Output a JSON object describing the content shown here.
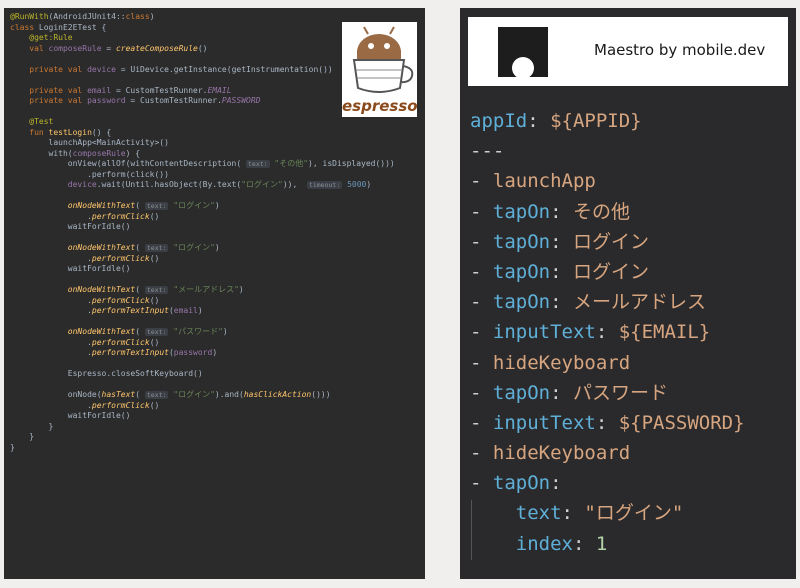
{
  "espresso": {
    "logo_text": "espresso",
    "lines": [
      {
        "i": 0,
        "parts": [
          [
            "ann",
            "@RunWith"
          ],
          [
            "t",
            "(AndroidJUnit4::"
          ],
          [
            "kw",
            "class"
          ],
          [
            "t",
            ")"
          ]
        ]
      },
      {
        "i": 0,
        "parts": [
          [
            "kw",
            "class "
          ],
          [
            "t",
            "LoginE2ETest {"
          ]
        ]
      },
      {
        "i": 1,
        "parts": [
          [
            "ann",
            "@get:Rule"
          ]
        ]
      },
      {
        "i": 1,
        "parts": [
          [
            "kw",
            "val "
          ],
          [
            "prop",
            "composeRule"
          ],
          [
            "t",
            " = "
          ],
          [
            "it",
            "createComposeRule"
          ],
          [
            "t",
            "()"
          ]
        ]
      },
      {
        "i": 0,
        "parts": []
      },
      {
        "i": 1,
        "parts": [
          [
            "kw",
            "private val "
          ],
          [
            "prop",
            "device"
          ],
          [
            "t",
            " = UiDevice.getInstance(getInstrumentation())"
          ]
        ]
      },
      {
        "i": 0,
        "parts": []
      },
      {
        "i": 1,
        "parts": [
          [
            "kw",
            "private val "
          ],
          [
            "prop",
            "email"
          ],
          [
            "t",
            " = CustomTestRunner."
          ],
          [
            "cnst",
            "EMAIL"
          ]
        ]
      },
      {
        "i": 1,
        "parts": [
          [
            "kw",
            "private val "
          ],
          [
            "prop",
            "password"
          ],
          [
            "t",
            " = CustomTestRunner."
          ],
          [
            "cnst",
            "PASSWORD"
          ]
        ]
      },
      {
        "i": 0,
        "parts": []
      },
      {
        "i": 1,
        "parts": [
          [
            "ann",
            "@Test"
          ]
        ]
      },
      {
        "i": 1,
        "parts": [
          [
            "kw",
            "fun "
          ],
          [
            "fn",
            "testLogin"
          ],
          [
            "t",
            "() {"
          ]
        ]
      },
      {
        "i": 2,
        "parts": [
          [
            "t",
            "launchApp<MainActivity>()"
          ]
        ]
      },
      {
        "i": 2,
        "parts": [
          [
            "t",
            "with("
          ],
          [
            "prop",
            "composeRule"
          ],
          [
            "t",
            ") {"
          ]
        ]
      },
      {
        "i": 3,
        "parts": [
          [
            "t",
            "onView(allOf(withContentDescription( "
          ],
          [
            "hint",
            "text:"
          ],
          [
            "str",
            " \"その他\""
          ],
          [
            "t",
            "), isDisplayed()))"
          ]
        ]
      },
      {
        "i": 4,
        "parts": [
          [
            "t",
            ".perform(click())"
          ]
        ]
      },
      {
        "i": 3,
        "parts": [
          [
            "prop",
            "device"
          ],
          [
            "t",
            ".wait(Until.hasObject(By.text("
          ],
          [
            "str",
            "\"ログイン\""
          ],
          [
            "t",
            ")),  "
          ],
          [
            "hint",
            "timeout:"
          ],
          [
            "num",
            " 5000"
          ],
          [
            "t",
            ")"
          ]
        ]
      },
      {
        "i": 0,
        "parts": []
      },
      {
        "i": 3,
        "parts": [
          [
            "it",
            "onNodeWithText"
          ],
          [
            "t",
            "( "
          ],
          [
            "hint",
            "text:"
          ],
          [
            "str",
            " \"ログイン\""
          ],
          [
            "t",
            ")"
          ]
        ]
      },
      {
        "i": 4,
        "parts": [
          [
            "t",
            "."
          ],
          [
            "it",
            "performClick"
          ],
          [
            "t",
            "()"
          ]
        ]
      },
      {
        "i": 3,
        "parts": [
          [
            "t",
            "waitForIdle()"
          ]
        ]
      },
      {
        "i": 0,
        "parts": []
      },
      {
        "i": 3,
        "parts": [
          [
            "it",
            "onNodeWithText"
          ],
          [
            "t",
            "( "
          ],
          [
            "hint",
            "text:"
          ],
          [
            "str",
            " \"ログイン\""
          ],
          [
            "t",
            ")"
          ]
        ]
      },
      {
        "i": 4,
        "parts": [
          [
            "t",
            "."
          ],
          [
            "it",
            "performClick"
          ],
          [
            "t",
            "()"
          ]
        ]
      },
      {
        "i": 3,
        "parts": [
          [
            "t",
            "waitForIdle()"
          ]
        ]
      },
      {
        "i": 0,
        "parts": []
      },
      {
        "i": 3,
        "parts": [
          [
            "it",
            "onNodeWithText"
          ],
          [
            "t",
            "( "
          ],
          [
            "hint",
            "text:"
          ],
          [
            "str",
            " \"メールアドレス\""
          ],
          [
            "t",
            ")"
          ]
        ]
      },
      {
        "i": 4,
        "parts": [
          [
            "t",
            "."
          ],
          [
            "it",
            "performClick"
          ],
          [
            "t",
            "()"
          ]
        ]
      },
      {
        "i": 4,
        "parts": [
          [
            "t",
            "."
          ],
          [
            "it",
            "performTextInput"
          ],
          [
            "t",
            "("
          ],
          [
            "prop",
            "email"
          ],
          [
            "t",
            ")"
          ]
        ]
      },
      {
        "i": 0,
        "parts": []
      },
      {
        "i": 3,
        "parts": [
          [
            "it",
            "onNodeWithText"
          ],
          [
            "t",
            "( "
          ],
          [
            "hint",
            "text:"
          ],
          [
            "str",
            " \"パスワード\""
          ],
          [
            "t",
            ")"
          ]
        ]
      },
      {
        "i": 4,
        "parts": [
          [
            "t",
            "."
          ],
          [
            "it",
            "performClick"
          ],
          [
            "t",
            "()"
          ]
        ]
      },
      {
        "i": 4,
        "parts": [
          [
            "t",
            "."
          ],
          [
            "it",
            "performTextInput"
          ],
          [
            "t",
            "("
          ],
          [
            "prop",
            "password"
          ],
          [
            "t",
            ")"
          ]
        ]
      },
      {
        "i": 0,
        "parts": []
      },
      {
        "i": 3,
        "parts": [
          [
            "t",
            "Espresso.closeSoftKeyboard()"
          ]
        ]
      },
      {
        "i": 0,
        "parts": []
      },
      {
        "i": 3,
        "parts": [
          [
            "t",
            "onNode("
          ],
          [
            "it",
            "hasText"
          ],
          [
            "t",
            "( "
          ],
          [
            "hint",
            "text:"
          ],
          [
            "str",
            " \"ログイン\""
          ],
          [
            "t",
            ").and("
          ],
          [
            "it",
            "hasClickAction"
          ],
          [
            "t",
            "()))"
          ]
        ]
      },
      {
        "i": 4,
        "parts": [
          [
            "t",
            "."
          ],
          [
            "it",
            "performClick"
          ],
          [
            "t",
            "()"
          ]
        ]
      },
      {
        "i": 3,
        "parts": [
          [
            "t",
            "waitForIdle()"
          ]
        ]
      },
      {
        "i": 2,
        "parts": [
          [
            "t",
            "}"
          ]
        ]
      },
      {
        "i": 1,
        "parts": [
          [
            "t",
            "}"
          ]
        ]
      },
      {
        "i": 0,
        "parts": [
          [
            "t",
            "}"
          ]
        ]
      }
    ]
  },
  "maestro": {
    "header_title": "Maestro by mobile.dev",
    "lines": [
      {
        "parts": [
          [
            "yk",
            "appId"
          ],
          [
            "yp",
            ": "
          ],
          [
            "yv",
            "${APPID}"
          ]
        ]
      },
      {
        "parts": [
          [
            "yp",
            "---"
          ]
        ]
      },
      {
        "parts": [
          [
            "yp",
            "- "
          ],
          [
            "yv",
            "launchApp"
          ]
        ]
      },
      {
        "parts": [
          [
            "yp",
            "- "
          ],
          [
            "yk",
            "tapOn"
          ],
          [
            "yp",
            ": "
          ],
          [
            "yv",
            "その他"
          ]
        ]
      },
      {
        "parts": [
          [
            "yp",
            "- "
          ],
          [
            "yk",
            "tapOn"
          ],
          [
            "yp",
            ": "
          ],
          [
            "yv",
            "ログイン"
          ]
        ]
      },
      {
        "parts": [
          [
            "yp",
            "- "
          ],
          [
            "yk",
            "tapOn"
          ],
          [
            "yp",
            ": "
          ],
          [
            "yv",
            "ログイン"
          ]
        ]
      },
      {
        "parts": [
          [
            "yp",
            "- "
          ],
          [
            "yk",
            "tapOn"
          ],
          [
            "yp",
            ": "
          ],
          [
            "yv",
            "メールアドレス"
          ]
        ]
      },
      {
        "parts": [
          [
            "yp",
            "- "
          ],
          [
            "yk",
            "inputText"
          ],
          [
            "yp",
            ": "
          ],
          [
            "yv",
            "${EMAIL}"
          ]
        ]
      },
      {
        "parts": [
          [
            "yp",
            "- "
          ],
          [
            "yv",
            "hideKeyboard"
          ]
        ]
      },
      {
        "parts": [
          [
            "yp",
            "- "
          ],
          [
            "yk",
            "tapOn"
          ],
          [
            "yp",
            ": "
          ],
          [
            "yv",
            "パスワード"
          ]
        ]
      },
      {
        "parts": [
          [
            "yp",
            "- "
          ],
          [
            "yk",
            "inputText"
          ],
          [
            "yp",
            ": "
          ],
          [
            "yv",
            "${PASSWORD}"
          ]
        ]
      },
      {
        "parts": [
          [
            "yp",
            "- "
          ],
          [
            "yv",
            "hideKeyboard"
          ]
        ]
      },
      {
        "parts": [
          [
            "yp",
            "- "
          ],
          [
            "yk",
            "tapOn"
          ],
          [
            "yp",
            ":"
          ]
        ]
      },
      {
        "parts": [
          [
            "yp",
            "    "
          ],
          [
            "yk",
            "text"
          ],
          [
            "yp",
            ": "
          ],
          [
            "yv",
            "\"ログイン\""
          ]
        ]
      },
      {
        "parts": [
          [
            "yp",
            "    "
          ],
          [
            "yk",
            "index"
          ],
          [
            "yp",
            ": "
          ],
          [
            "yn",
            "1"
          ]
        ]
      }
    ]
  }
}
